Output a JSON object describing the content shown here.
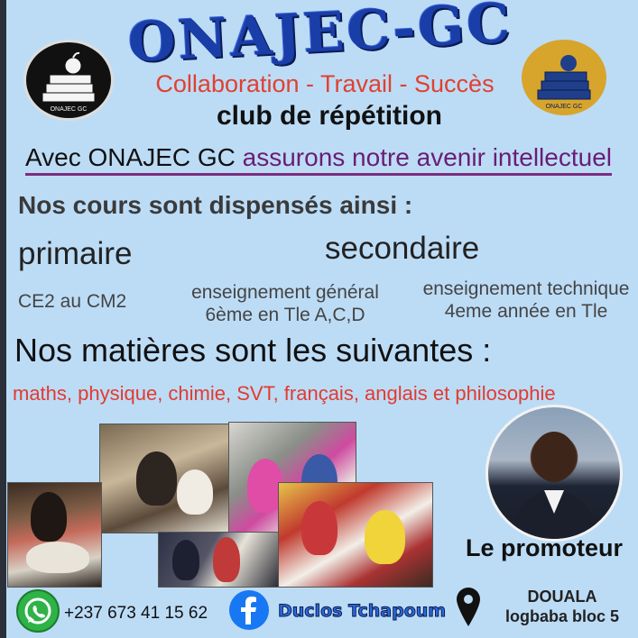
{
  "header": {
    "title": "ONAJEC-GC",
    "tagline": "Collaboration - Travail - Succès",
    "subtitle": "club de répétition",
    "slogan_prefix": "Avec ONAJEC GC ",
    "slogan_accent": "assurons notre avenir intellectuel",
    "logo_text": "ONAJEC GC"
  },
  "courses": {
    "heading": "Nos cours sont dispensés ainsi :",
    "primaire": {
      "label": "primaire",
      "detail": "CE2 au CM2"
    },
    "secondaire": {
      "label": "secondaire",
      "general_line1": "enseignement général",
      "general_line2": "6ème en Tle A,C,D",
      "technique_line1": "enseignement technique",
      "technique_line2": "4eme année en Tle"
    }
  },
  "subjects": {
    "heading": "Nos matières sont les suivantes :",
    "list": "maths, physique, chimie, SVT, français, anglais et philosophie"
  },
  "promoteur": {
    "label": "Le promoteur"
  },
  "contact": {
    "phone": "+237 673 41 15 62",
    "facebook": "Duclos Tchapoum",
    "city": "DOUALA",
    "location": "logbaba bloc 5"
  },
  "colors": {
    "background": "#bcdcf6",
    "title_blue": "#1a3ea8",
    "tagline_red": "#e2402f",
    "subjects_red": "#e33b2f",
    "whatsapp_green": "#2fb247",
    "facebook_blue": "#1877f2"
  },
  "icons": [
    "whatsapp-icon",
    "facebook-icon",
    "location-pin-icon",
    "book-stack-icon"
  ]
}
